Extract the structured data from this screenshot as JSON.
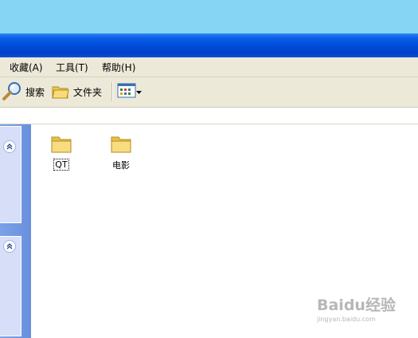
{
  "menu": {
    "items": [
      "收藏(A)",
      "工具(T)",
      "帮助(H)"
    ]
  },
  "toolbar": {
    "search_label": "搜索",
    "folders_label": "文件夹"
  },
  "folders": [
    {
      "name": "QT",
      "selected": true
    },
    {
      "name": "电影",
      "selected": false
    }
  ],
  "watermark": {
    "title": "Baidu经验",
    "url": "jingyan.baidu.com"
  },
  "colors": {
    "titlebar": "#0049d8",
    "menubar": "#ece9d8",
    "task_pane": "#7ba1e7",
    "desktop": "#86d5f4"
  }
}
